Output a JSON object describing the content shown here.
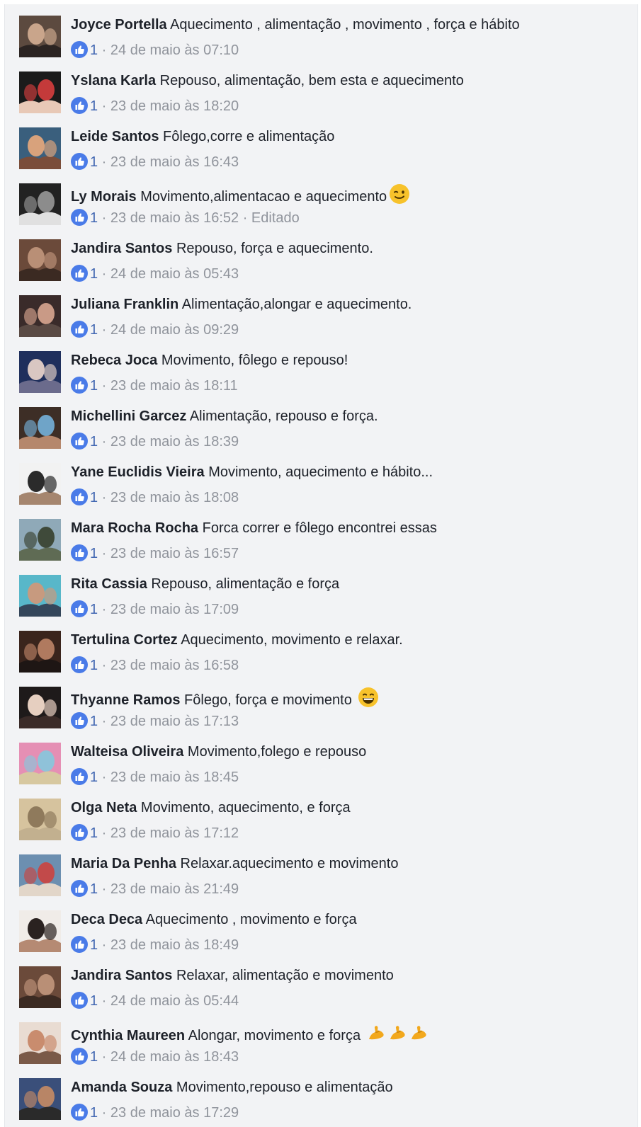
{
  "comments": [
    {
      "author": "Joyce Portella",
      "text": "Aquecimento , alimentação , movimento , força e hábito",
      "likes": "1",
      "sep": " · ",
      "time": "24 de maio às 07:10",
      "extra": "",
      "emoji": "",
      "avatar_colors": [
        "#5c4a3f",
        "#c9a58b",
        "#2b2422"
      ]
    },
    {
      "author": "Yslana Karla",
      "text": "Repouso, alimentação, bem esta e aquecimento",
      "likes": "1",
      "sep": " · ",
      "time": "23 de maio às 18:20",
      "extra": "",
      "emoji": "",
      "avatar_colors": [
        "#1b1b1b",
        "#c43a3a",
        "#e8c9b7"
      ]
    },
    {
      "author": "Leide Santos",
      "text": "Fôlego,corre e alimentação",
      "likes": "1",
      "sep": " · ",
      "time": "23 de maio às 16:43",
      "extra": "",
      "emoji": "",
      "avatar_colors": [
        "#3a5f7d",
        "#d8a27c",
        "#7a4d3a"
      ]
    },
    {
      "author": "Ly Morais",
      "text": "Movimento,alimentacao e aquecimento",
      "likes": "1",
      "sep": " · ",
      "time": "23 de maio às 16:52",
      "extra": " · Editado",
      "emoji": "wink",
      "avatar_colors": [
        "#222222",
        "#8c8c8c",
        "#e0e0e0"
      ]
    },
    {
      "author": "Jandira Santos",
      "text": "Repouso, força e aquecimento.",
      "likes": "1",
      "sep": " · ",
      "time": "24 de maio às 05:43",
      "extra": "",
      "emoji": "",
      "avatar_colors": [
        "#6b4a3a",
        "#b98f76",
        "#3b2a22"
      ]
    },
    {
      "author": "Juliana Franklin",
      "text": "Alimentação,alongar e aquecimento.",
      "likes": "1",
      "sep": " · ",
      "time": "24 de maio às 09:29",
      "extra": "",
      "emoji": "",
      "avatar_colors": [
        "#3a2b2a",
        "#c99a86",
        "#5a4a44"
      ]
    },
    {
      "author": "Rebeca Joca",
      "text": "Movimento, fôlego e repouso!",
      "likes": "1",
      "sep": " · ",
      "time": "23 de maio às 18:11",
      "extra": "",
      "emoji": "",
      "avatar_colors": [
        "#1f2f5c",
        "#d9c7c2",
        "#6b6b8c"
      ]
    },
    {
      "author": "Michellini Garcez",
      "text": "Alimentação, repouso e força.",
      "likes": "1",
      "sep": " · ",
      "time": "23 de maio às 18:39",
      "extra": "",
      "emoji": "",
      "avatar_colors": [
        "#3d2e26",
        "#6fa4c8",
        "#b5876c"
      ]
    },
    {
      "author": "Yane Euclidis Vieira",
      "text": "Movimento, aquecimento e hábito...",
      "likes": "1",
      "sep": " · ",
      "time": "23 de maio às 18:08",
      "extra": "",
      "emoji": "",
      "avatar_colors": [
        "#f2f2f2",
        "#2b2b2b",
        "#a5866f"
      ]
    },
    {
      "author": "Mara Rocha Rocha",
      "text": "Forca correr e fôlego encontrei essas",
      "likes": "1",
      "sep": " · ",
      "time": "23 de maio às 16:57",
      "extra": "",
      "emoji": "",
      "avatar_colors": [
        "#8fa9b8",
        "#3f4a3a",
        "#5f6b54"
      ]
    },
    {
      "author": "Rita Cassia",
      "text": "Repouso, alimentação e força",
      "likes": "1",
      "sep": " · ",
      "time": "23 de maio às 17:09",
      "extra": "",
      "emoji": "",
      "avatar_colors": [
        "#58b7c9",
        "#c79a7f",
        "#34465a"
      ]
    },
    {
      "author": "Tertulina Cortez",
      "text": "Aquecimento, movimento e relaxar.",
      "likes": "1",
      "sep": " · ",
      "time": "23 de maio às 16:58",
      "extra": "",
      "emoji": "",
      "avatar_colors": [
        "#3a241c",
        "#b07a5f",
        "#1e1614"
      ]
    },
    {
      "author": "Thyanne Ramos",
      "text": "Fôlego, força e movimento",
      "likes": "1",
      "sep": " · ",
      "time": "23 de maio às 17:13",
      "extra": "",
      "emoji": "grin",
      "avatar_colors": [
        "#1e1a1a",
        "#e6cfc0",
        "#3a2b28"
      ]
    },
    {
      "author": "Walteisa Oliveira",
      "text": "Movimento,folego e repouso",
      "likes": "1",
      "sep": " · ",
      "time": "23 de maio às 18:45",
      "extra": "",
      "emoji": "",
      "avatar_colors": [
        "#e58fb4",
        "#8fc2d9",
        "#d7c8a0"
      ]
    },
    {
      "author": "Olga Neta",
      "text": "Movimento, aquecimento, e força",
      "likes": "1",
      "sep": " · ",
      "time": "23 de maio às 17:12",
      "extra": "",
      "emoji": "",
      "avatar_colors": [
        "#d6c39e",
        "#8f7a5c",
        "#c2b08f"
      ]
    },
    {
      "author": "Maria Da Penha",
      "text": "Relaxar.aquecimento e movimento",
      "likes": "1",
      "sep": " · ",
      "time": "23 de maio às 21:49",
      "extra": "",
      "emoji": "",
      "avatar_colors": [
        "#6c8fb0",
        "#c24a4a",
        "#e2d6c9"
      ]
    },
    {
      "author": "Deca Deca",
      "text": "Aquecimento , movimento e força",
      "likes": "1",
      "sep": " · ",
      "time": "23 de maio às 18:49",
      "extra": "",
      "emoji": "",
      "avatar_colors": [
        "#f0ece8",
        "#2a2220",
        "#b58a73"
      ]
    },
    {
      "author": "Jandira Santos",
      "text": "Relaxar, alimentação e movimento",
      "likes": "1",
      "sep": " · ",
      "time": "24 de maio às 05:44",
      "extra": "",
      "emoji": "",
      "avatar_colors": [
        "#6b4a3a",
        "#b98f76",
        "#3b2a22"
      ]
    },
    {
      "author": "Cynthia Maureen",
      "text": "Alongar, movimento e força",
      "likes": "1",
      "sep": " · ",
      "time": "24 de maio às 18:43",
      "extra": "",
      "emoji": "muscle3",
      "avatar_colors": [
        "#e9dcd2",
        "#c98c6e",
        "#7a5a48"
      ]
    },
    {
      "author": "Amanda Souza",
      "text": "Movimento,repouso e alimentação",
      "likes": "1",
      "sep": " · ",
      "time": "23 de maio às 17:29",
      "extra": "",
      "emoji": "",
      "avatar_colors": [
        "#3a4f7a",
        "#b88566",
        "#2a2a2a"
      ]
    }
  ],
  "colors": {
    "background": "#f2f3f5",
    "author": "#1d2129",
    "meta": "#90949c",
    "like_blue": "#4267b2",
    "emoji_yellow": "#f7c22b"
  },
  "icons": {
    "like": "thumbs-up-icon",
    "wink": "winking-face-emoji",
    "grin": "grinning-face-emoji",
    "muscle": "flexed-biceps-emoji"
  }
}
